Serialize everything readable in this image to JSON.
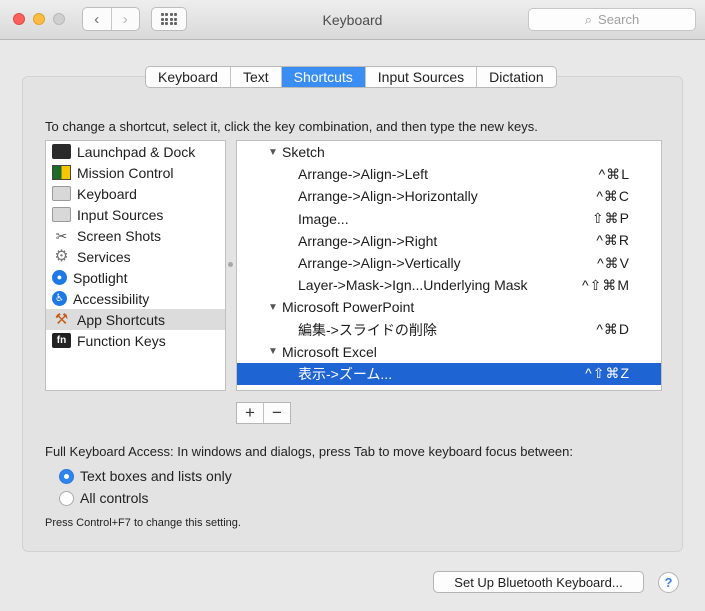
{
  "window": {
    "title": "Keyboard"
  },
  "toolbar": {
    "back_icon": "‹",
    "forward_icon": "›",
    "search_placeholder": "Search",
    "search_icon": "⌕"
  },
  "tabs": [
    {
      "label": "Keyboard",
      "active": false
    },
    {
      "label": "Text",
      "active": false
    },
    {
      "label": "Shortcuts",
      "active": true
    },
    {
      "label": "Input Sources",
      "active": false
    },
    {
      "label": "Dictation",
      "active": false
    }
  ],
  "instructions": "To change a shortcut, select it, click the key combination, and then type the new keys.",
  "categories": [
    {
      "label": "Launchpad & Dock",
      "icon": "launchpad-icon"
    },
    {
      "label": "Mission Control",
      "icon": "mission-control-icon"
    },
    {
      "label": "Keyboard",
      "icon": "keyboard-icon"
    },
    {
      "label": "Input Sources",
      "icon": "input-sources-icon"
    },
    {
      "label": "Screen Shots",
      "icon": "camera-icon"
    },
    {
      "label": "Services",
      "icon": "gear-icon"
    },
    {
      "label": "Spotlight",
      "icon": "spotlight-icon"
    },
    {
      "label": "Accessibility",
      "icon": "accessibility-icon"
    },
    {
      "label": "App Shortcuts",
      "icon": "app-store-icon",
      "selected": true
    },
    {
      "label": "Function Keys",
      "icon": "fn-key-icon"
    }
  ],
  "shortcuts": [
    {
      "type": "group",
      "label": "Sketch"
    },
    {
      "type": "item",
      "label": "Arrange->Align->Left",
      "keys": "^⌘L"
    },
    {
      "type": "item",
      "label": "Arrange->Align->Horizontally",
      "keys": "^⌘C"
    },
    {
      "type": "item",
      "label": "Image...",
      "keys": "⇧⌘P"
    },
    {
      "type": "item",
      "label": "Arrange->Align->Right",
      "keys": "^⌘R"
    },
    {
      "type": "item",
      "label": "Arrange->Align->Vertically",
      "keys": "^⌘V"
    },
    {
      "type": "item",
      "label": "Layer->Mask->Ign...Underlying Mask",
      "keys": "^⇧⌘M"
    },
    {
      "type": "group",
      "label": "Microsoft PowerPoint"
    },
    {
      "type": "item",
      "label": "編集->スライドの削除",
      "keys": "^⌘D"
    },
    {
      "type": "group",
      "label": "Microsoft Excel"
    },
    {
      "type": "item",
      "label": "表示->ズーム...",
      "keys": "^⇧⌘Z",
      "selected": true
    }
  ],
  "list_controls": {
    "add": "+",
    "remove": "−"
  },
  "full_keyboard_access": {
    "label": "Full Keyboard Access: In windows and dialogs, press Tab to move keyboard focus between:",
    "options": [
      {
        "label": "Text boxes and lists only",
        "selected": true
      },
      {
        "label": "All controls",
        "selected": false
      }
    ],
    "hint": "Press Control+F7 to change this setting."
  },
  "footer": {
    "bluetooth_button": "Set Up Bluetooth Keyboard...",
    "help_button": "?"
  }
}
